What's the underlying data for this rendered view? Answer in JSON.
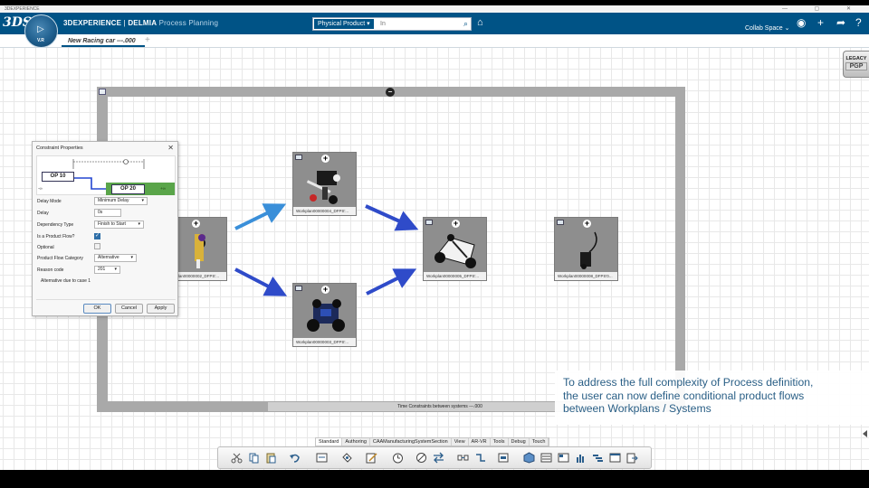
{
  "os": {
    "title": "3DEXPERIENCE",
    "controls": "— ▢ ✕"
  },
  "header": {
    "logo": "3DS",
    "brand": "3DEXPERIENCE",
    "separator": " | ",
    "product": "DELMIA",
    "app": "Process Planning",
    "search": {
      "scope": "Physical Product ▾",
      "placeholder": "In"
    },
    "collab_space": "Collab Space ⌄",
    "compass_version": "V.R"
  },
  "tab": {
    "label": "New Racing car ---.000",
    "add": "+"
  },
  "system": {
    "bar_label": "Time Constraints between systems ---.000"
  },
  "nodes": [
    {
      "id": "n1",
      "label": "Workplan00000002_DFPS'..."
    },
    {
      "id": "n2",
      "label": "Workplan00000004_DFPS'..."
    },
    {
      "id": "n3",
      "label": "Workplan00000003_DFPS'..."
    },
    {
      "id": "n4",
      "label": "Workplan00000005_DFPS'..."
    },
    {
      "id": "n5",
      "label": "Workplan00000008_DFPS'0..."
    }
  ],
  "dialog": {
    "title": "Constraint Properties",
    "op_from": "OP 10",
    "op_to": "OP 20",
    "inf_from": "-∞",
    "inf_to": "+∞",
    "rows": {
      "delay_mode": {
        "label": "Delay Mode",
        "value": "Minimum Delay"
      },
      "delay": {
        "label": "Delay",
        "value": "0s"
      },
      "dependency_type": {
        "label": "Dependency Type",
        "value": "Finish to Start"
      },
      "product_flow": {
        "label": "Is a Product Flow?",
        "checked": true
      },
      "optional": {
        "label": "Optional",
        "checked": false
      },
      "flow_category": {
        "label": "Product Flow Category",
        "value": "Alternative"
      },
      "reason_code": {
        "label": "Reason code",
        "value": "201"
      }
    },
    "note": "Alternative due to case 1",
    "buttons": {
      "ok": "OK",
      "cancel": "Cancel",
      "apply": "Apply"
    }
  },
  "legacy": {
    "line1": "LEGACY",
    "line2": "PGP"
  },
  "caption": [
    "To address the full complexity of Process definition,",
    "the user can now define conditional product flows",
    "between Workplans / Systems"
  ],
  "action_tabs": [
    "Standard",
    "Authoring",
    "CAAManufacturingSystemSection",
    "View",
    "AR-VR",
    "Tools",
    "Debug",
    "Touch"
  ],
  "action_icons": [
    "cut-icon",
    "copy-icon",
    "paste-icon",
    "undo-icon",
    "system-icon",
    "link-icon",
    "edit-icon",
    "timer-icon",
    "flow-icon",
    "swap-icon",
    "constraint-icon",
    "connect-icon",
    "assign-icon",
    "cube-icon",
    "list-icon",
    "table-icon",
    "chart-icon",
    "gantt-icon",
    "window-icon",
    "export-icon"
  ],
  "colors": {
    "brand": "#005386",
    "accent": "#2f4bc9",
    "flow_alt": "#3a8fd9",
    "green": "#5aa54a"
  }
}
